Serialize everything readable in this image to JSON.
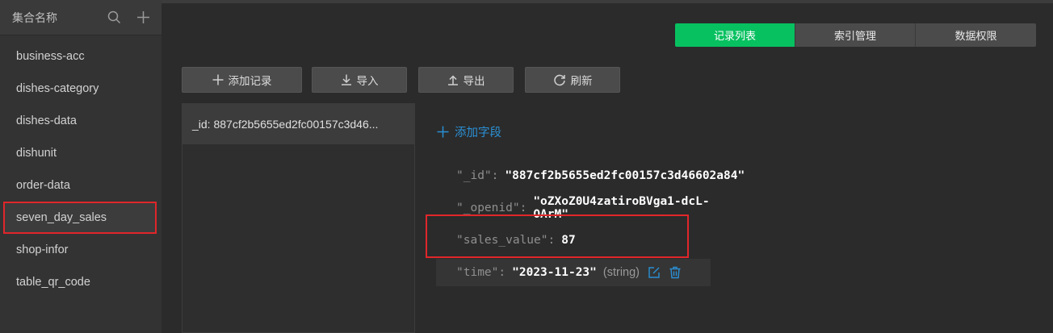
{
  "sidebar": {
    "title": "集合名称",
    "collections": [
      {
        "label": "business-acc"
      },
      {
        "label": "dishes-category"
      },
      {
        "label": "dishes-data"
      },
      {
        "label": "dishunit"
      },
      {
        "label": "order-data"
      },
      {
        "label": "seven_day_sales"
      },
      {
        "label": "shop-infor"
      },
      {
        "label": "table_qr_code"
      }
    ],
    "active_collection": "seven_day_sales"
  },
  "tabs": [
    {
      "label": "记录列表"
    },
    {
      "label": "索引管理"
    },
    {
      "label": "数据权限"
    }
  ],
  "active_tab": "记录列表",
  "toolbar": {
    "add_label": "添加记录",
    "import_label": "导入",
    "export_label": "导出",
    "refresh_label": "刷新"
  },
  "records": [
    {
      "label": "_id: 887cf2b5655ed2fc00157c3d46..."
    }
  ],
  "detail": {
    "add_field_label": "添加字段",
    "fields": [
      {
        "key": "\"_id\"",
        "value": "\"887cf2b5655ed2fc00157c3d46602a84\""
      },
      {
        "key": "\"_openid\"",
        "value": "\"oZXoZ0U4zatiroBVga1-dcL-OArM\""
      },
      {
        "key": "\"sales_value\"",
        "value": "87"
      },
      {
        "key": "\"time\"",
        "value": "\"2023-11-23\"",
        "type": "(string)"
      }
    ]
  },
  "colors": {
    "accent_green": "#07c160",
    "link_blue": "#2a8fd4",
    "highlight_red": "#e0262a"
  }
}
